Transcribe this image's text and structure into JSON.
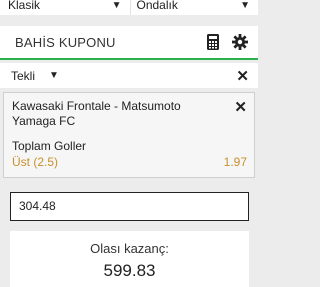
{
  "top": {
    "bet_mode": "Klasik",
    "odds_format": "Ondalık"
  },
  "header": {
    "title": "BAHİS KUPONU"
  },
  "bet_type": {
    "value": "Tekli"
  },
  "selection": {
    "match": "Kawasaki Frontale - Matsumoto Yamaga FC",
    "market": "Toplam Goller",
    "pick": "Üst (2.5)",
    "odds": "1.97"
  },
  "stake": {
    "value": "304.48"
  },
  "winnings": {
    "label": "Olası kazanç:",
    "value": "599.83"
  },
  "colors": {
    "accent": "#2bb24c",
    "odds": "#c8902d"
  }
}
